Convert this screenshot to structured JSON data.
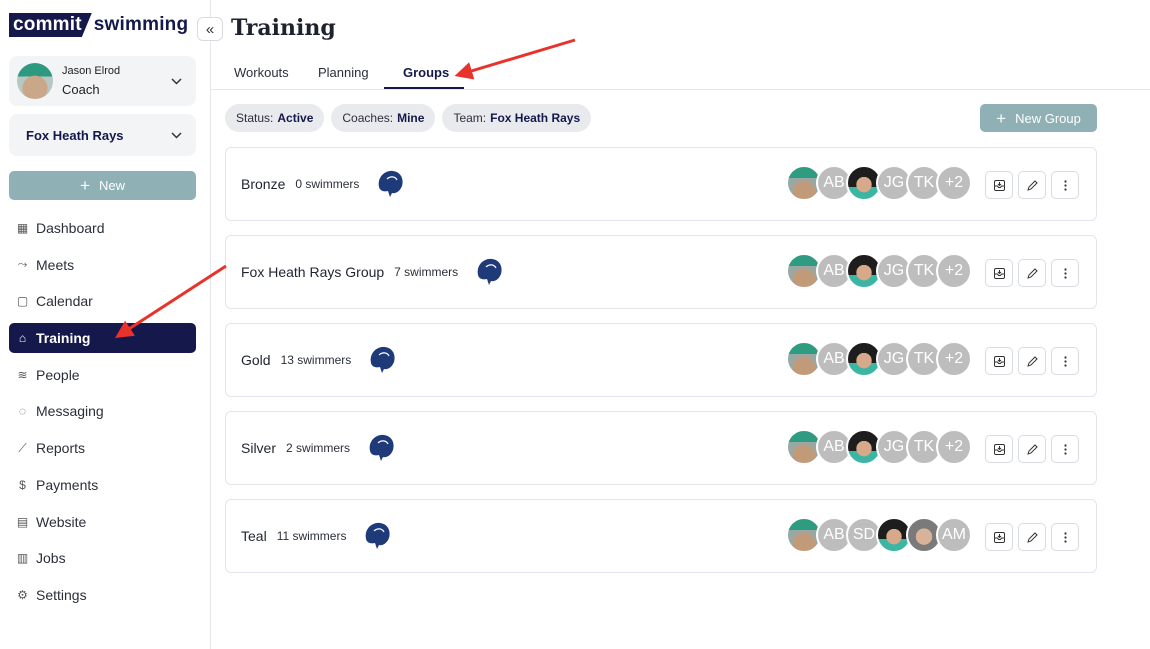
{
  "brand": {
    "logo_box": "commit",
    "logo_text": "swimming"
  },
  "sidebar": {
    "collapse": "«",
    "user": {
      "name": "Jason Elrod",
      "role": "Coach"
    },
    "team": "Fox Heath Rays",
    "new_button": "New",
    "items": [
      {
        "label": "Dashboard",
        "icon": "dashboard-icon",
        "glyph": "▦"
      },
      {
        "label": "Meets",
        "icon": "meets-icon",
        "glyph": "⤳"
      },
      {
        "label": "Calendar",
        "icon": "calendar-icon",
        "glyph": "▢"
      },
      {
        "label": "Training",
        "icon": "training-icon",
        "glyph": "⌂"
      },
      {
        "label": "People",
        "icon": "people-icon",
        "glyph": "≋"
      },
      {
        "label": "Messaging",
        "icon": "messaging-icon",
        "glyph": "◌"
      },
      {
        "label": "Reports",
        "icon": "reports-icon",
        "glyph": "⟋"
      },
      {
        "label": "Payments",
        "icon": "payments-icon",
        "glyph": "$"
      },
      {
        "label": "Website",
        "icon": "website-icon",
        "glyph": "▤"
      },
      {
        "label": "Jobs",
        "icon": "jobs-icon",
        "glyph": "▥"
      },
      {
        "label": "Settings",
        "icon": "settings-icon",
        "glyph": "⚙"
      }
    ],
    "active": "Training"
  },
  "main": {
    "title": "Training",
    "tabs": [
      "Workouts",
      "Planning",
      "Groups"
    ],
    "active_tab": "Groups",
    "filters": [
      {
        "key": "Status:",
        "value": "Active"
      },
      {
        "key": "Coaches:",
        "value": "Mine"
      },
      {
        "key": "Team:",
        "value": "Fox Heath Rays"
      }
    ],
    "new_group_button": "New Group",
    "groups": [
      {
        "name": "Bronze",
        "count": "0 swimmers",
        "avatars": [
          "photo1",
          "AB",
          "photo2",
          "JG",
          "TK",
          "+2"
        ]
      },
      {
        "name": "Fox Heath Rays Group",
        "count": "7 swimmers",
        "avatars": [
          "photo1",
          "AB",
          "photo2",
          "JG",
          "TK",
          "+2"
        ]
      },
      {
        "name": "Gold",
        "count": "13 swimmers",
        "avatars": [
          "photo1",
          "AB",
          "photo2",
          "JG",
          "TK",
          "+2"
        ]
      },
      {
        "name": "Silver",
        "count": "2 swimmers",
        "avatars": [
          "photo1",
          "AB",
          "photo2",
          "JG",
          "TK",
          "+2"
        ]
      },
      {
        "name": "Teal",
        "count": "11 swimmers",
        "avatars": [
          "photo1",
          "AB",
          "SD",
          "photo2",
          "photo3",
          "AM"
        ]
      }
    ]
  },
  "colors": {
    "brand_navy": "#15184a",
    "accent_teal": "#8fb0b4",
    "arrow_red": "#e8322a"
  }
}
